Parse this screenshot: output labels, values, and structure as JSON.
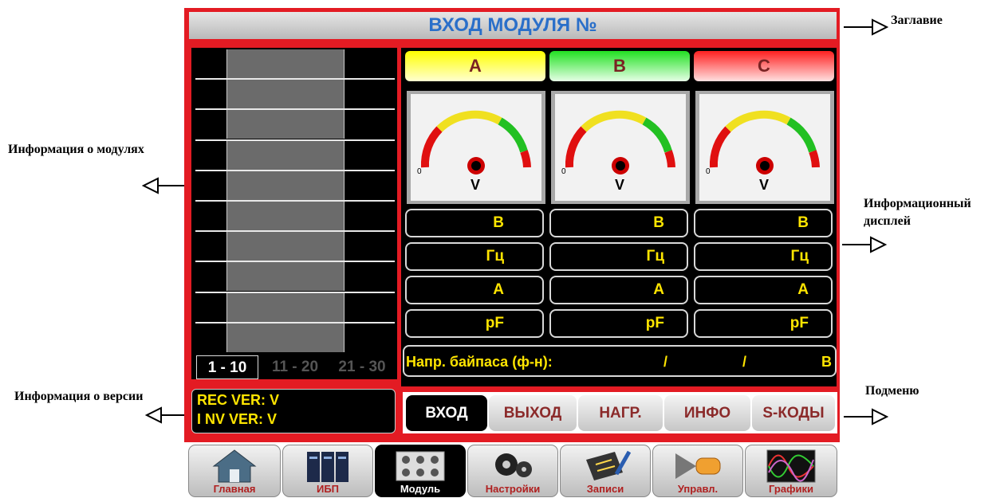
{
  "annotations": {
    "title": "Заглавие",
    "modules": "Информация о  модулях",
    "display_line1": "Информационный",
    "display_line2": "дисплей",
    "version": "Информация о версии",
    "submenu": "Подменю"
  },
  "screen": {
    "title": "ВХОД МОДУЛЯ №",
    "pages": [
      "1 - 10",
      "11 - 20",
      "21 - 30"
    ],
    "phases": [
      {
        "name": "A",
        "color": "#ffff00"
      },
      {
        "name": "B",
        "color": "#22e022"
      },
      {
        "name": "C",
        "color": "#ff2b2b"
      }
    ],
    "gauge": {
      "zero": "0",
      "unit": "V"
    },
    "units": [
      "В",
      "Гц",
      "А",
      "pF"
    ],
    "bypass": {
      "label": "Напр. байпаса (ф-н):",
      "sep1": "/",
      "sep2": "/",
      "unit": "В"
    },
    "version": {
      "rec": "REC VER: V",
      "inv": "I NV  VER: V"
    },
    "submenu": [
      "ВХОД",
      "ВЫХОД",
      "НАГР.",
      "ИНФО",
      "S-КОДЫ"
    ],
    "nav": [
      "Главная",
      "ИБП",
      "Модуль",
      "Настройки",
      "Записи",
      "Управл.",
      "Графики"
    ]
  }
}
